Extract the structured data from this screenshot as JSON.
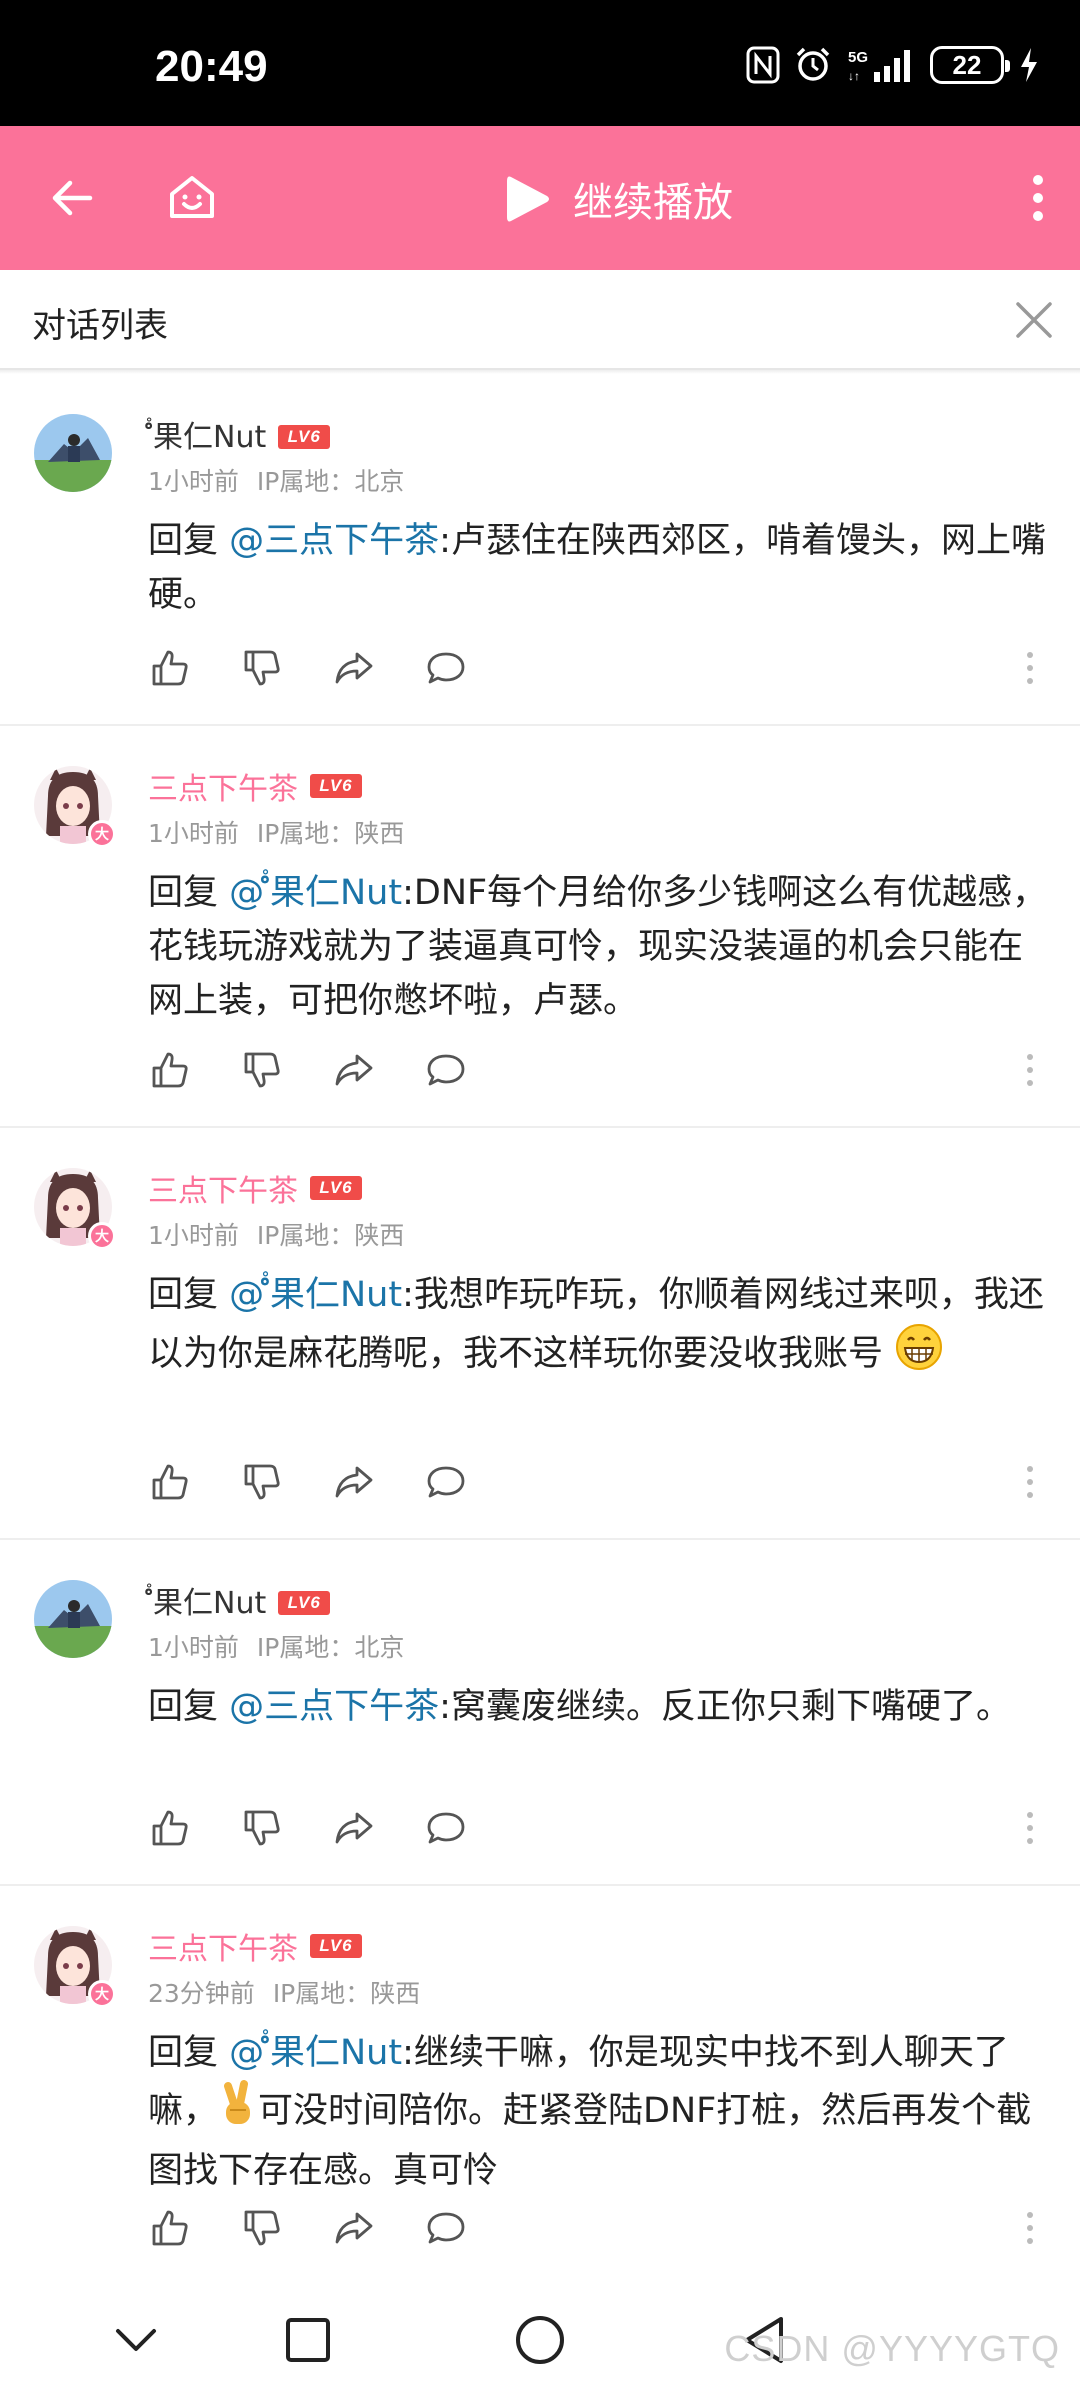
{
  "status_bar": {
    "time": "20:49",
    "network": "5G",
    "battery": "22"
  },
  "app_bar": {
    "continue_label": "继续播放",
    "accent_color": "#fb7299"
  },
  "dialog": {
    "title": "对话列表"
  },
  "comments": [
    {
      "user": "༌༌༌果仁Nut",
      "user_display": "‭ํํ果仁Nut",
      "level": "LV6",
      "time": "1小时前",
      "ip": "IP属地：北京",
      "reply_prefix": "回复",
      "mention": "@ ํํ果仁Nut",
      "text": ":卢瑟住在陕西郊区，啃着馒头，网上嘴硬。",
      "mention_target": "@三点下午茶"
    },
    {
      "user": "三点下午茶",
      "level": "LV6",
      "time": "1小时前",
      "ip": "IP属地：陕西",
      "reply_prefix": "回复",
      "mention_target": "@ ํํ果仁Nut",
      "text": ":DNF每个月给你多少钱啊这么有优越感，花钱玩游戏就为了装逼真可怜，现实没装逼的机会只能在网上装，可把你憋坏啦，卢瑟。"
    },
    {
      "user": "三点下午茶",
      "level": "LV6",
      "time": "1小时前",
      "ip": "IP属地：陕西",
      "reply_prefix": "回复",
      "mention_target": "@ ํํ果仁Nut",
      "text": ":我想咋玩咋玩，你顺着网线过来呗，我还以为你是麻花腾呢，我不这样玩你要没收我账号"
    },
    {
      "user": "‭ํํ果仁Nut",
      "level": "LV6",
      "time": "1小时前",
      "ip": "IP属地：北京",
      "reply_prefix": "回复",
      "mention_target": "@三点下午茶",
      "text": ":窝囊废继续。反正你只剩下嘴硬了。"
    },
    {
      "user": "三点下午茶",
      "level": "LV6",
      "time": "23分钟前",
      "ip": "IP属地：陕西",
      "reply_prefix": "回复",
      "mention_target": "@ ํํ果仁Nut",
      "text_a": ":继续干嘛，你是现实中找不到人聊天了嘛，",
      "text_b": "可没时间陪你。赶紧登陆DNF打桩，然后再发个截图找下存在感。真可怜"
    }
  ],
  "names": {
    "nut": " ํํ果仁Nut",
    "tea": "三点下午茶"
  },
  "watermark": "CSDN @YYYYGTQ",
  "icons": [
    "back-arrow-icon",
    "home-tv-icon",
    "play-icon",
    "more-vertical-icon",
    "close-icon",
    "thumb-up-icon",
    "thumb-down-icon",
    "share-icon",
    "comment-icon",
    "nav-back-icon",
    "nav-home-icon",
    "nav-recent-icon",
    "nav-collapse-icon"
  ]
}
